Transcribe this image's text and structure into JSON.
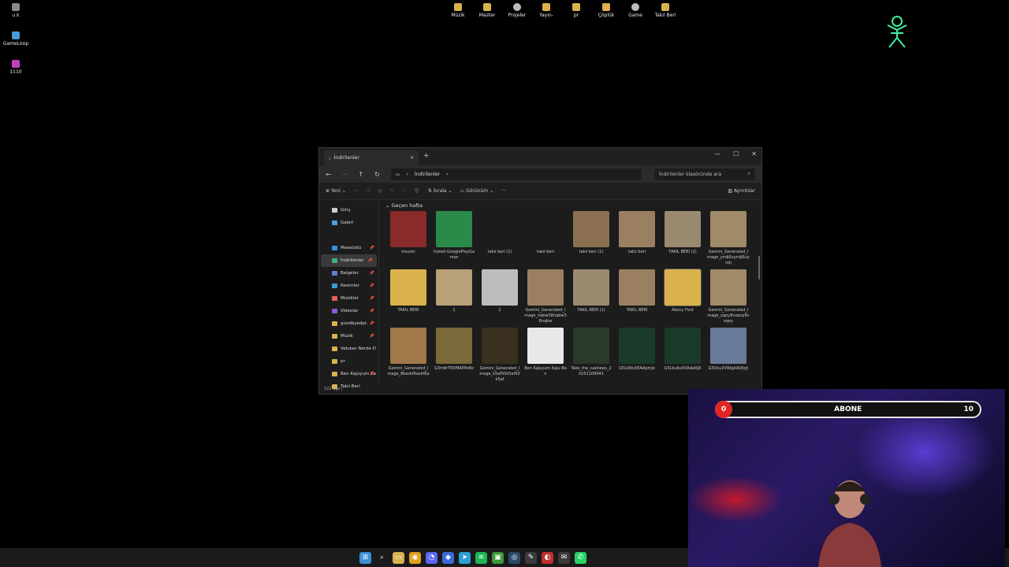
{
  "desktop": {
    "left_icons": [
      {
        "label": "u.k",
        "icon": "recycle-bin-icon"
      },
      {
        "label": "GameLoop",
        "icon": "gameloop-icon"
      },
      {
        "label": "1110",
        "icon": "file-icon"
      }
    ],
    "top_icons": [
      {
        "label": "Müzik",
        "icon": "folder-icon"
      },
      {
        "label": "Master",
        "icon": "folder-icon"
      },
      {
        "label": "Projeler",
        "icon": "app-icon"
      },
      {
        "label": "Yayın-",
        "icon": "folder-icon"
      },
      {
        "label": "pr",
        "icon": "folder-icon"
      },
      {
        "label": "Çöplük",
        "icon": "folder-icon"
      },
      {
        "label": "Game",
        "icon": "app-icon"
      },
      {
        "label": "Takıl Beri",
        "icon": "folder-icon"
      }
    ]
  },
  "explorer": {
    "tab_title": "İndirilenler",
    "breadcrumb": "İndirilenler",
    "search_placeholder": "İndirilenler klasöründe ara",
    "new_label": "Yeni",
    "sort_label": "Sırala",
    "view_label": "Görünüm",
    "details_label": "Ayrıntılar",
    "more_label": "···",
    "sidebar": [
      {
        "label": "Giriş",
        "icon": "home-icon",
        "pinned": false,
        "color": "#cfcfcf"
      },
      {
        "label": "Galeri",
        "icon": "gallery-icon",
        "pinned": false,
        "color": "#4aa0e0"
      },
      {
        "label": "Masaüstü",
        "icon": "desktop-icon",
        "pinned": true,
        "color": "#3a8fd8"
      },
      {
        "label": "İndirilenler",
        "icon": "download-icon",
        "pinned": true,
        "color": "#3ab07a"
      },
      {
        "label": "Belgeler",
        "icon": "documents-icon",
        "pinned": true,
        "color": "#5a7fd0"
      },
      {
        "label": "Resimler",
        "icon": "pictures-icon",
        "pinned": true,
        "color": "#3a9fd8"
      },
      {
        "label": "Müzikler",
        "icon": "music-icon",
        "pinned": true,
        "color": "#e0605a"
      },
      {
        "label": "Videolar",
        "icon": "videos-icon",
        "pinned": true,
        "color": "#8a5ad8"
      },
      {
        "label": "goodbyedpi-",
        "icon": "folder-icon",
        "pinned": true,
        "color": "#d9b24c"
      },
      {
        "label": "Müzik",
        "icon": "folder-icon",
        "pinned": true,
        "color": "#d9b24c"
      },
      {
        "label": "Velutan Nerde D",
        "icon": "folder-icon",
        "pinned": false,
        "color": "#d9b24c"
      },
      {
        "label": "pr",
        "icon": "folder-icon",
        "pinned": false,
        "color": "#d9b24c"
      },
      {
        "label": "Ben Kajuyum Ka",
        "icon": "folder-icon",
        "pinned": true,
        "color": "#d9b24c"
      },
      {
        "label": "Takıl Beri",
        "icon": "folder-icon",
        "pinned": false,
        "color": "#d9b24c"
      }
    ],
    "group_header": "Geçen hafta",
    "files": [
      {
        "label": "Insurer",
        "color": "#8a2a2a"
      },
      {
        "label": "Install-GooglePlayGames",
        "color": "#2a8a4a"
      },
      {
        "label": "takıl beri (1)",
        "color": "#1c1c1c"
      },
      {
        "label": "takıl beri",
        "color": "#1c1c1c"
      },
      {
        "label": "takıl beri (1)",
        "color": "#8a7050"
      },
      {
        "label": "takıl beri",
        "color": "#9a8060"
      },
      {
        "label": "TAKIL BERİ (2)",
        "color": "#9a8a70"
      },
      {
        "label": "Gemini_Generated_Image_yndj6uyndj6uyndj",
        "color": "#a08a68"
      },
      {
        "label": "TAKIL BERİ",
        "color": "#d9b24c"
      },
      {
        "label": "1",
        "color": "#b8a078"
      },
      {
        "label": "2",
        "color": "#bdbdbd"
      },
      {
        "label": "Gemini_Generated_Image_nqbw38nqbw38nqbw",
        "color": "#9a8060"
      },
      {
        "label": "TAKIL BERİ (1)",
        "color": "#9a8a70"
      },
      {
        "label": "TAKIL BERİ",
        "color": "#9a8060"
      },
      {
        "label": "Akony Font",
        "color": "#d9b24c"
      },
      {
        "label": "Gemini_Generated_Image_xqoy8vxqoy8vxqoy",
        "color": "#a08a68"
      },
      {
        "label": "Gemini_Generated_Image_8baskf6askf6a",
        "color": "#a0784a"
      },
      {
        "label": "G3m8rT8XMAEPeNz",
        "color": "#7a6a3a"
      },
      {
        "label": "Gemini_Generated_Image_k5af50k5af50k5af",
        "color": "#3a3020"
      },
      {
        "label": "Ben Kajuyum Kaju Ben",
        "color": "#e8e8e8"
      },
      {
        "label": "Take_the_cashews_20251109041",
        "color": "#2a3a2a"
      },
      {
        "label": "G5LbNxXEAApmJo",
        "color": "#1a3a2a"
      },
      {
        "label": "G5Lbu6sX0AAeRJA",
        "color": "#1a3a2a"
      },
      {
        "label": "G5Osu3VWgAAQ0gt",
        "color": "#6a7a9a"
      }
    ],
    "status": "522 öğe  |"
  },
  "taskbar": [
    {
      "name": "start-icon",
      "color": "#3a8fd8",
      "glyph": "⊞"
    },
    {
      "name": "search-icon",
      "color": "#1a1a1a",
      "glyph": "⌕"
    },
    {
      "name": "file-explorer-icon",
      "color": "#d9b24c",
      "glyph": "▭"
    },
    {
      "name": "chrome-icon",
      "color": "#e0a020",
      "glyph": "◉"
    },
    {
      "name": "discord-icon",
      "color": "#5865f2",
      "glyph": "◔"
    },
    {
      "name": "app-icon",
      "color": "#3a6ad8",
      "glyph": "◆"
    },
    {
      "name": "telegram-icon",
      "color": "#2aa0d8",
      "glyph": "➤"
    },
    {
      "name": "spotify-icon",
      "color": "#1db954",
      "glyph": "≋"
    },
    {
      "name": "xbox-icon",
      "color": "#3a9a3a",
      "glyph": "▣"
    },
    {
      "name": "steam-icon",
      "color": "#2a4a6a",
      "glyph": "◎"
    },
    {
      "name": "app-icon",
      "color": "#3a3a3a",
      "glyph": "✎"
    },
    {
      "name": "app-icon",
      "color": "#c03030",
      "glyph": "◐"
    },
    {
      "name": "app-icon",
      "color": "#3a3a3a",
      "glyph": "✉"
    },
    {
      "name": "whatsapp-icon",
      "color": "#25d366",
      "glyph": "✆"
    }
  ],
  "webcam": {
    "sub_start": "0",
    "sub_label": "ABONE",
    "sub_goal": "10",
    "sub_progress": 0.03
  }
}
